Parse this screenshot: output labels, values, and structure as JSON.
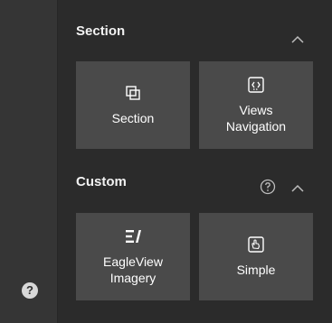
{
  "sections": [
    {
      "title": "Section",
      "tiles": [
        {
          "label": "Section",
          "icon": "layers-icon"
        },
        {
          "label": "Views\nNavigation",
          "icon": "views-navigation-icon"
        }
      ]
    },
    {
      "title": "Custom",
      "tiles": [
        {
          "label": "EagleView\nImagery",
          "icon": "eagleview-logo-icon"
        },
        {
          "label": "Simple",
          "icon": "hand-icon"
        }
      ]
    }
  ],
  "help_glyph": "?",
  "colors": {
    "tile": "#4a4a4a",
    "panel": "#2b2b2b",
    "rail": "#353535"
  }
}
